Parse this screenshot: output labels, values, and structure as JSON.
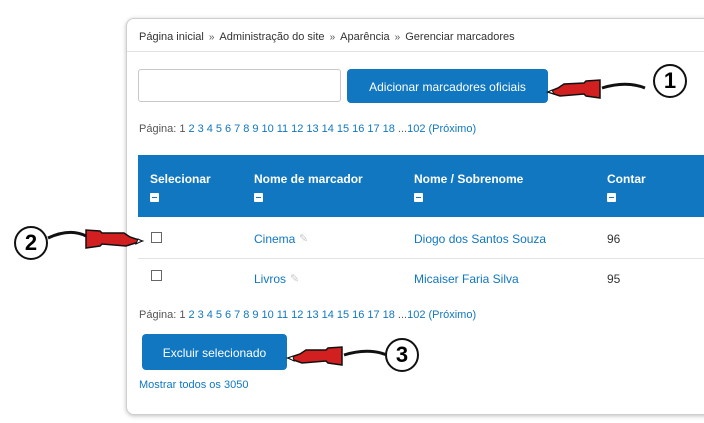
{
  "breadcrumb": [
    "Página inicial",
    "Administração do site",
    "Aparência",
    "Gerenciar marcadores"
  ],
  "breadcrumb_separator": "»",
  "tag_input": {
    "value": "",
    "placeholder": ""
  },
  "add_button": "Adicionar marcadores oficiais",
  "pagination": {
    "label": "Página:",
    "first": "1",
    "pages": [
      "2",
      "3",
      "4",
      "5",
      "6",
      "7",
      "8",
      "9",
      "10",
      "11",
      "12",
      "13",
      "14",
      "15",
      "16",
      "17",
      "18"
    ],
    "ellipsis": "...",
    "last": "102",
    "next": "(Próximo)"
  },
  "table": {
    "headers": [
      "Selecionar",
      "Nome de marcador",
      "Nome / Sobrenome",
      "Contar"
    ],
    "rows": [
      {
        "tag": "Cinema",
        "name": "Diogo dos Santos Souza",
        "count": "96"
      },
      {
        "tag": "Livros",
        "name": "Micaiser Faria Silva",
        "count": "95"
      }
    ]
  },
  "delete_button": "Excluir selecionado",
  "show_all": "Mostrar todos os 3050",
  "annotations": [
    "1",
    "2",
    "3"
  ],
  "colors": {
    "accent": "#1177c0",
    "annotation": "#d21f1f"
  }
}
